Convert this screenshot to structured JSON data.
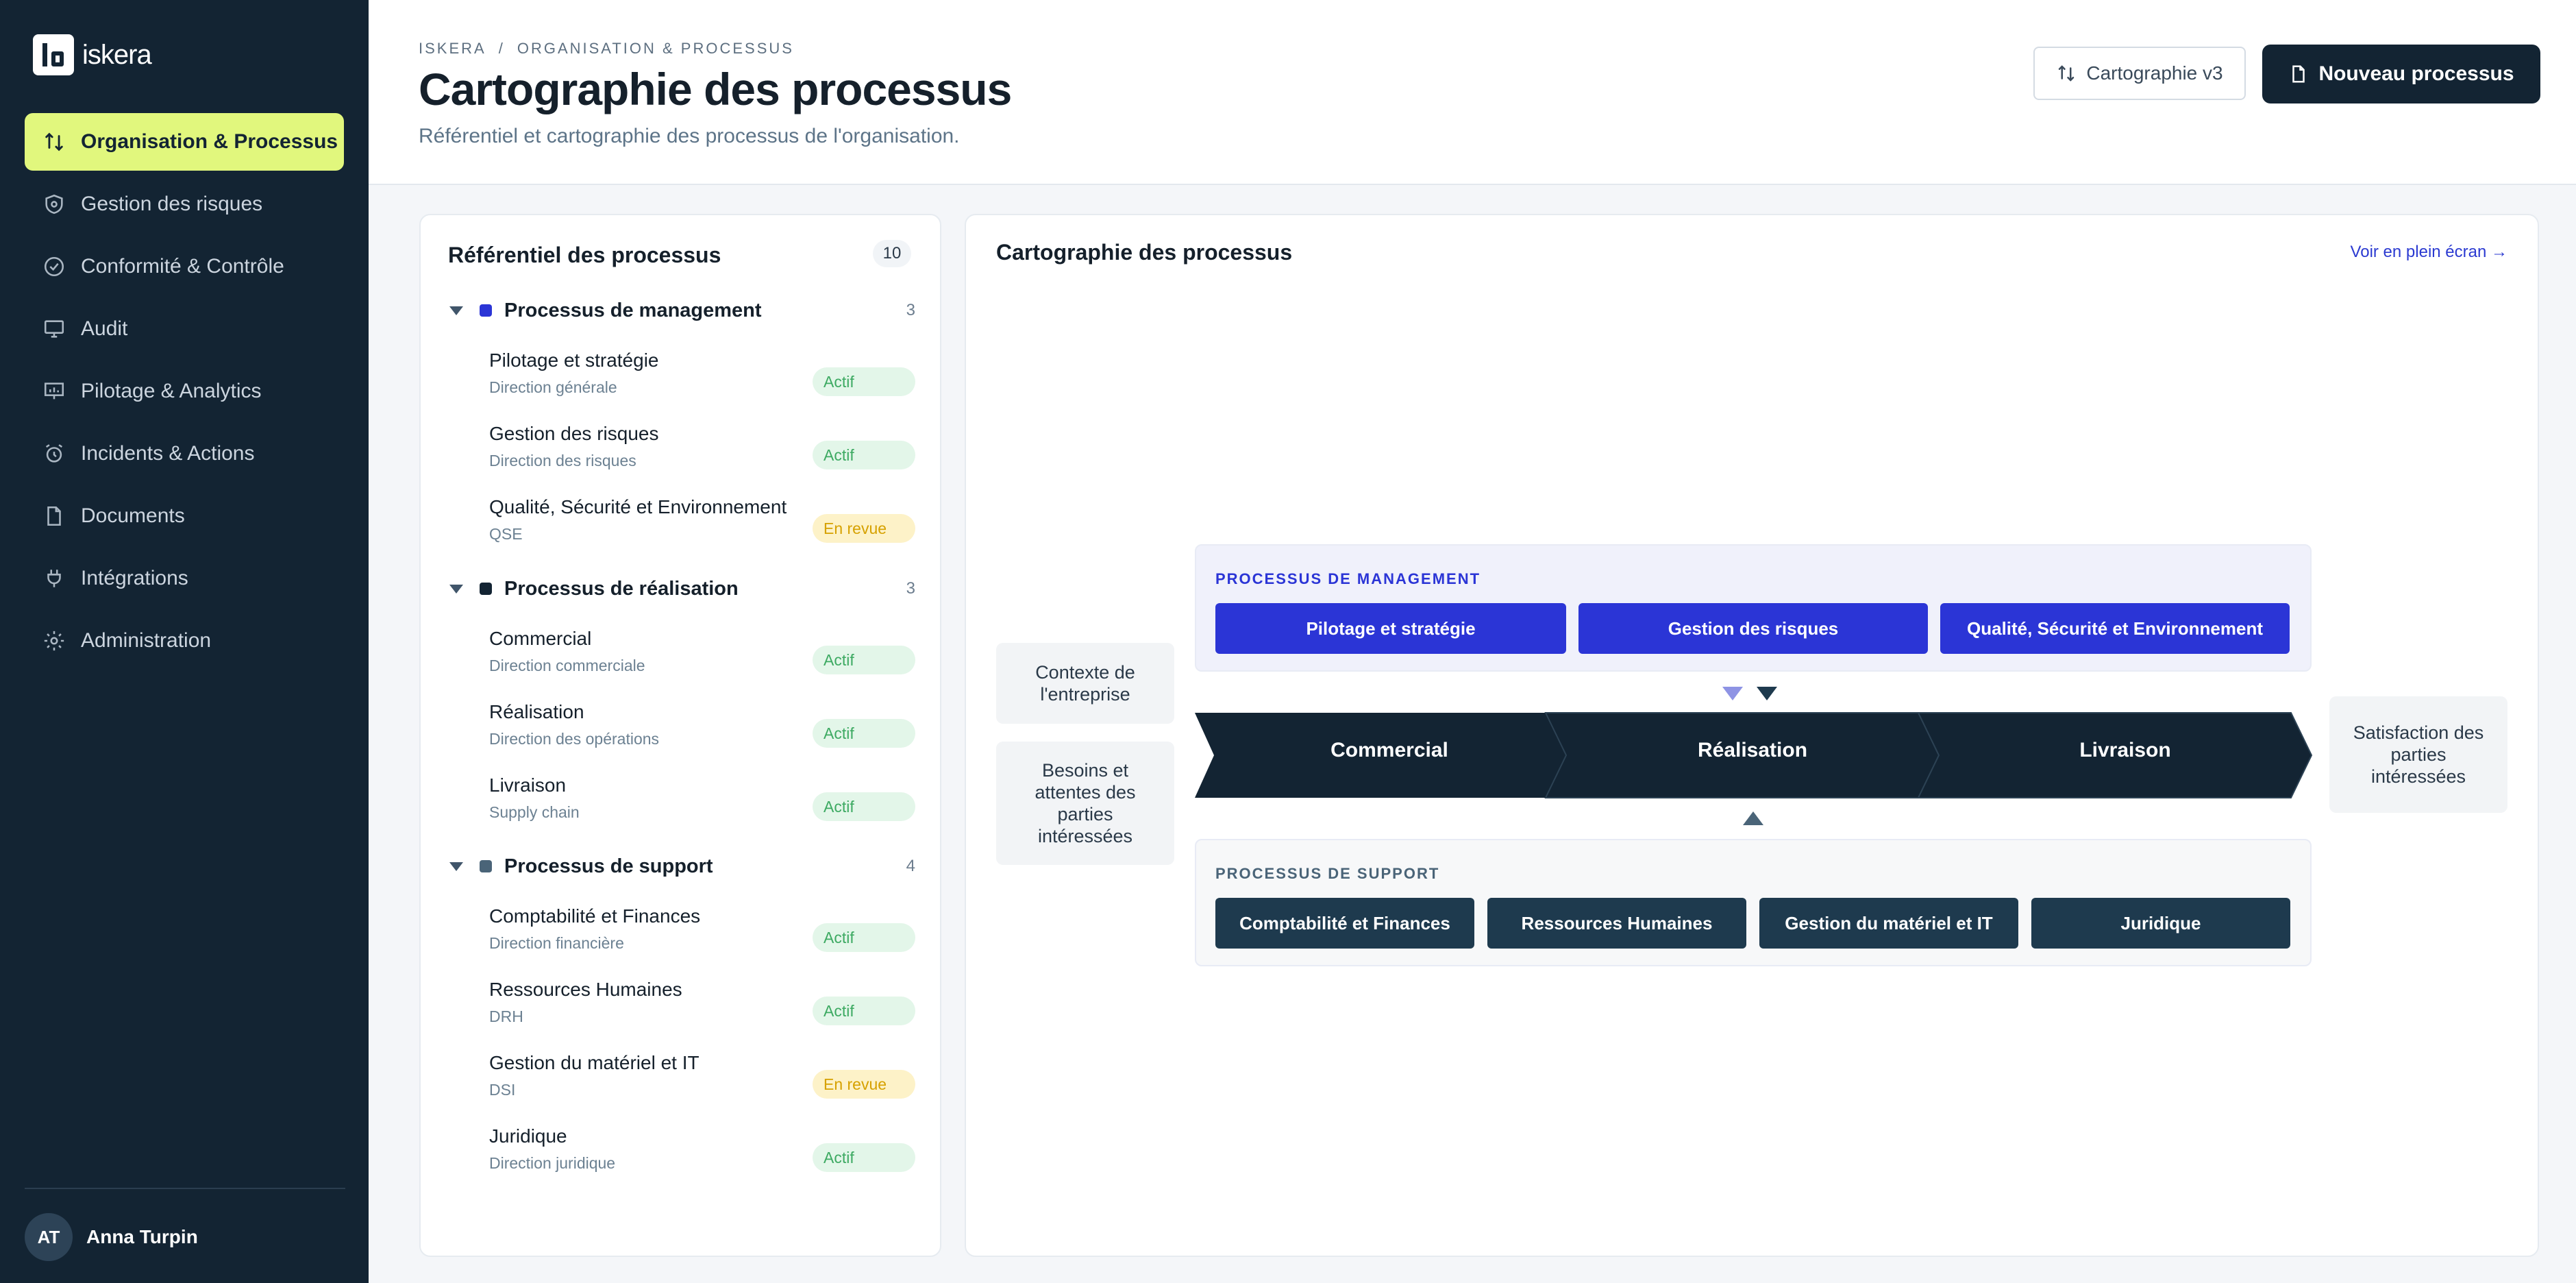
{
  "app": {
    "brand": "iskera"
  },
  "sidebar": {
    "items": [
      {
        "label": "Organisation & Processus",
        "icon": "swap-arrows-icon",
        "active": true
      },
      {
        "label": "Gestion des risques",
        "icon": "shield-icon"
      },
      {
        "label": "Conformité & Contrôle",
        "icon": "check-circle-icon"
      },
      {
        "label": "Audit",
        "icon": "monitor-icon"
      },
      {
        "label": "Pilotage & Analytics",
        "icon": "presentation-chart-icon"
      },
      {
        "label": "Incidents & Actions",
        "icon": "alarm-clock-icon"
      },
      {
        "label": "Documents",
        "icon": "document-icon"
      },
      {
        "label": "Intégrations",
        "icon": "plug-icon"
      },
      {
        "label": "Administration",
        "icon": "gear-icon"
      }
    ],
    "user": {
      "initials": "AT",
      "name": "Anna Turpin"
    }
  },
  "header": {
    "breadcrumb": [
      "ISKERA",
      "/",
      "ORGANISATION & PROCESSUS"
    ],
    "title": "Cartographie des processus",
    "subtitle": "Référentiel et cartographie des processus de l'organisation.",
    "version_button": "Cartographie v3",
    "new_button": "Nouveau processus"
  },
  "referentiel": {
    "title": "Référentiel des processus",
    "count": "10",
    "groups": [
      {
        "label": "Processus de management",
        "count": "3",
        "color": "#2b35d6",
        "items": [
          {
            "name": "Pilotage et stratégie",
            "owner": "Direction générale",
            "status": "Actif"
          },
          {
            "name": "Gestion des risques",
            "owner": "Direction des risques",
            "status": "Actif"
          },
          {
            "name": "Qualité, Sécurité et Environnement",
            "owner": "QSE",
            "status": "En revue"
          }
        ]
      },
      {
        "label": "Processus de réalisation",
        "count": "3",
        "color": "#132433",
        "items": [
          {
            "name": "Commercial",
            "owner": "Direction commerciale",
            "status": "Actif"
          },
          {
            "name": "Réalisation",
            "owner": "Direction des opérations",
            "status": "Actif"
          },
          {
            "name": "Livraison",
            "owner": "Supply chain",
            "status": "Actif"
          }
        ]
      },
      {
        "label": "Processus de support",
        "count": "4",
        "color": "#4a6478",
        "items": [
          {
            "name": "Comptabilité et Finances",
            "owner": "Direction financière",
            "status": "Actif"
          },
          {
            "name": "Ressources Humaines",
            "owner": "DRH",
            "status": "Actif"
          },
          {
            "name": "Gestion du matériel et IT",
            "owner": "DSI",
            "status": "En revue"
          },
          {
            "name": "Juridique",
            "owner": "Direction juridique",
            "status": "Actif"
          }
        ]
      }
    ]
  },
  "map": {
    "title": "Cartographie des processus",
    "fullscreen_link": "Voir en plein écran →",
    "inputs": [
      "Contexte de l'entreprise",
      "Besoins et attentes des parties intéressées"
    ],
    "output": "Satisfaction des parties intéressées",
    "management": {
      "label": "PROCESSUS DE MANAGEMENT",
      "items": [
        "Pilotage et stratégie",
        "Gestion des risques",
        "Qualité, Sécurité et Environnement"
      ]
    },
    "realisation": [
      "Commercial",
      "Réalisation",
      "Livraison"
    ],
    "support": {
      "label": "PROCESSUS DE SUPPORT",
      "items": [
        "Comptabilité et Finances",
        "Ressources Humaines",
        "Gestion du matériel et IT",
        "Juridique"
      ]
    }
  },
  "colors": {
    "accent": "#e1f77d",
    "sidebar": "#132433",
    "management": "#2b35d6",
    "support": "#1e3a4e",
    "badge_ok": "#3daa62",
    "badge_review": "#d6a100"
  }
}
